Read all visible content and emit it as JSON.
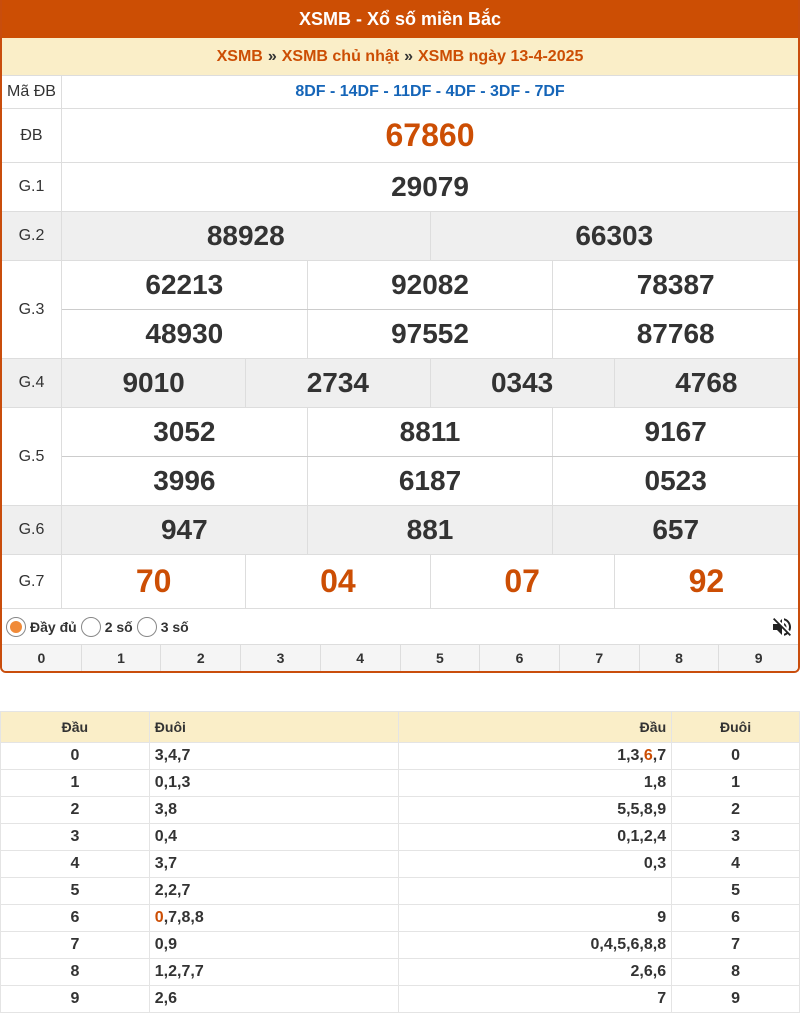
{
  "header": {
    "title": "XSMB - Xổ số miền Bắc"
  },
  "breadcrumb": {
    "items": [
      "XSMB",
      "XSMB chủ nhật",
      "XSMB ngày 13-4-2025"
    ],
    "separator": "»"
  },
  "result": {
    "code_label": "Mã ĐB",
    "codes": "8DF - 14DF - 11DF - 4DF - 3DF - 7DF",
    "labels": {
      "db": "ĐB",
      "g1": "G.1",
      "g2": "G.2",
      "g3": "G.3",
      "g4": "G.4",
      "g5": "G.5",
      "g6": "G.6",
      "g7": "G.7"
    },
    "db": "67860",
    "g1": "29079",
    "g2": [
      "88928",
      "66303"
    ],
    "g3": [
      "62213",
      "92082",
      "78387",
      "48930",
      "97552",
      "87768"
    ],
    "g4": [
      "9010",
      "2734",
      "0343",
      "4768"
    ],
    "g5": [
      "3052",
      "8811",
      "9167",
      "3996",
      "6187",
      "0523"
    ],
    "g6": [
      "947",
      "881",
      "657"
    ],
    "g7": [
      "70",
      "04",
      "07",
      "92"
    ]
  },
  "options": {
    "items": [
      "Đầy đủ",
      "2 số",
      "3 số"
    ],
    "selected": "Đầy đủ",
    "mute_icon": "volume-off-icon"
  },
  "digit_filter": [
    "0",
    "1",
    "2",
    "3",
    "4",
    "5",
    "6",
    "7",
    "8",
    "9"
  ],
  "stats": {
    "headers": {
      "dau": "Đầu",
      "duoi": "Đuôi",
      "dau2": "Đầu",
      "duoi2": "Đuôi"
    },
    "rows": [
      {
        "head": "0",
        "tails": "3,4,7",
        "heads_pre": "1,3,",
        "heads_hot": "6",
        "heads_post": ",7",
        "tail": "0"
      },
      {
        "head": "1",
        "tails": "0,1,3",
        "heads_pre": "1,8",
        "heads_hot": "",
        "heads_post": "",
        "tail": "1"
      },
      {
        "head": "2",
        "tails": "3,8",
        "heads_pre": "5,5,8,9",
        "heads_hot": "",
        "heads_post": "",
        "tail": "2"
      },
      {
        "head": "3",
        "tails": "0,4",
        "heads_pre": "0,1,2,4",
        "heads_hot": "",
        "heads_post": "",
        "tail": "3"
      },
      {
        "head": "4",
        "tails": "3,7",
        "heads_pre": "0,3",
        "heads_hot": "",
        "heads_post": "",
        "tail": "4"
      },
      {
        "head": "5",
        "tails": "2,2,7",
        "heads_pre": "",
        "heads_hot": "",
        "heads_post": "",
        "tail": "5"
      },
      {
        "head": "6",
        "tails_hot": "0",
        "tails": ",7,8,8",
        "heads_pre": "9",
        "heads_hot": "",
        "heads_post": "",
        "tail": "6"
      },
      {
        "head": "7",
        "tails": "0,9",
        "heads_pre": "0,4,5,6,8,8",
        "heads_hot": "",
        "heads_post": "",
        "tail": "7"
      },
      {
        "head": "8",
        "tails": "1,2,7,7",
        "heads_pre": "2,6,6",
        "heads_hot": "",
        "heads_post": "",
        "tail": "8"
      },
      {
        "head": "9",
        "tails": "2,6",
        "heads_pre": "7",
        "heads_hot": "",
        "heads_post": "",
        "tail": "9"
      }
    ]
  },
  "colors": {
    "brand": "#cc4e04",
    "header_bg": "#faeec8",
    "code_blue": "#1565b8"
  }
}
